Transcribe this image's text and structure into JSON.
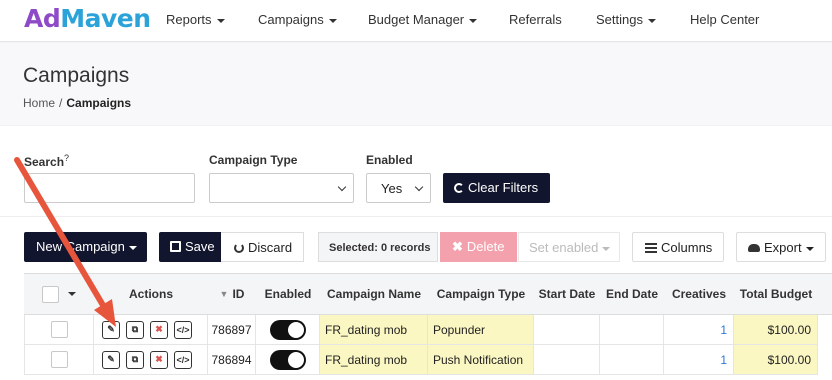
{
  "navbar": {
    "logo_a": "Ad",
    "logo_b": "Maven",
    "items": [
      {
        "label": "Reports"
      },
      {
        "label": "Campaigns"
      },
      {
        "label": "Budget Manager"
      },
      {
        "label": "Referrals"
      },
      {
        "label": "Settings"
      },
      {
        "label": "Help Center"
      }
    ]
  },
  "page": {
    "title": "Campaigns",
    "breadcrumb_home": "Home",
    "breadcrumb_sep": "/",
    "breadcrumb_current": "Campaigns"
  },
  "filters": {
    "search_label": "Search",
    "search_hint": "?",
    "search_value": "",
    "type_label": "Campaign Type",
    "type_value": "",
    "enabled_label": "Enabled",
    "enabled_value": "Yes",
    "clear_label": "Clear Filters"
  },
  "toolbar": {
    "new_campaign": "New Campaign",
    "save": "Save",
    "discard": "Discard",
    "selected": "Selected: 0 records",
    "delete": "Delete",
    "set_enabled": "Set enabled",
    "columns": "Columns",
    "export": "Export"
  },
  "table": {
    "headers": {
      "actions": "Actions",
      "id": "ID",
      "enabled": "Enabled",
      "name": "Campaign Name",
      "type": "Campaign Type",
      "start": "Start Date",
      "end": "End Date",
      "creatives": "Creatives",
      "budget": "Total Budget"
    },
    "rows": [
      {
        "id": "786897",
        "name": "FR_dating mob",
        "type": "Popunder",
        "start": "",
        "end": "",
        "creatives": "1",
        "budget": "$100.00",
        "enabled": true
      },
      {
        "id": "786894",
        "name": "FR_dating mob",
        "type": "Push Notification",
        "start": "",
        "end": "",
        "creatives": "1",
        "budget": "$100.00",
        "enabled": true
      }
    ]
  },
  "colors": {
    "brand_purple": "#8e4bc7",
    "brand_blue": "#2ba3d9",
    "dark_button": "#12152e",
    "delete_disabled": "#f3a2ad",
    "highlight": "#fbf7c3",
    "annotation_arrow": "#e8553d"
  },
  "icons": [
    "refresh-icon",
    "floppy-icon",
    "undo-icon",
    "times-icon",
    "columns-icon",
    "cloud-download-icon",
    "pencil-icon",
    "copy-icon",
    "code-icon",
    "sort-desc-icon"
  ]
}
